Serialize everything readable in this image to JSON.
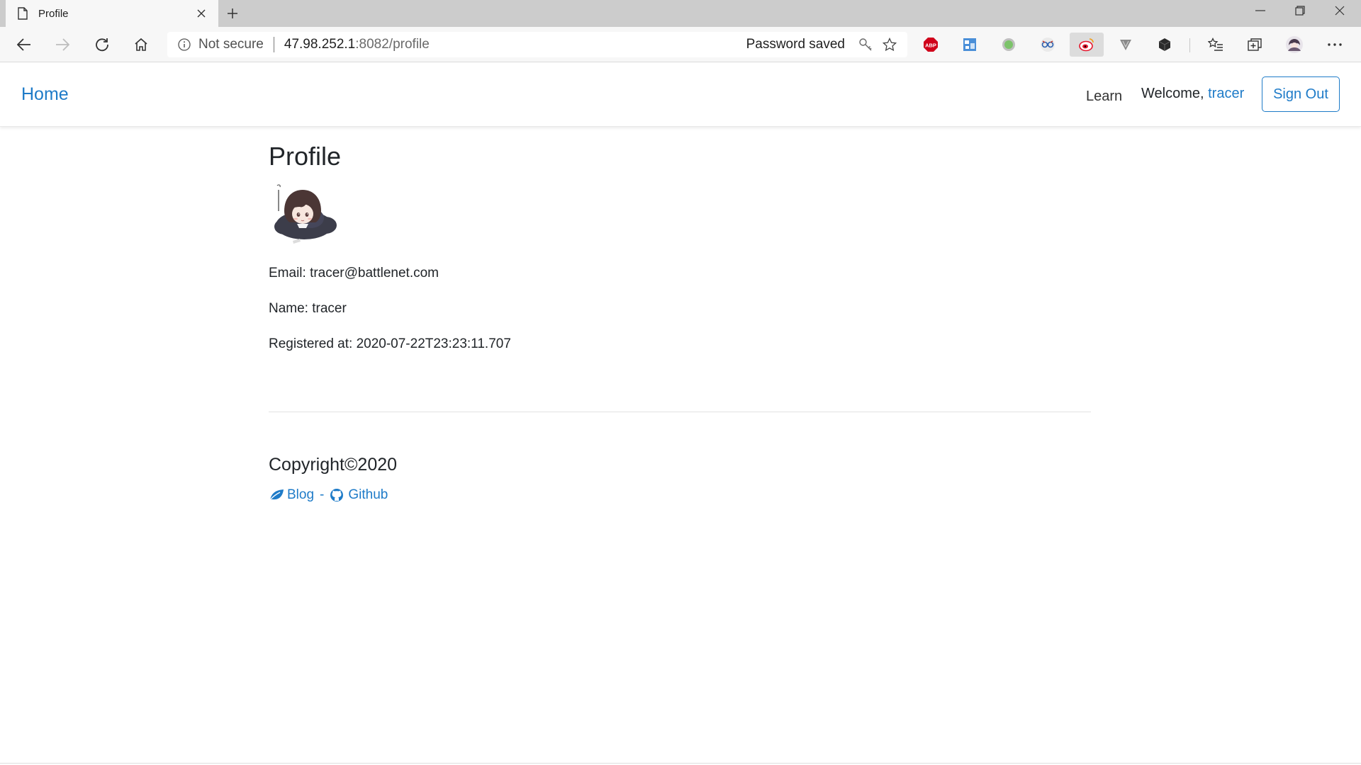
{
  "browser": {
    "tab_title": "Profile",
    "address": {
      "security_label": "Not secure",
      "url_host": "47.98.252.1",
      "url_rest": ":8082/profile",
      "password_status": "Password saved"
    },
    "extensions": [
      "adblock-icon",
      "translate-icon",
      "green-dot-icon",
      "glasses-icon",
      "weibo-icon",
      "v-shield-icon",
      "cube-icon"
    ]
  },
  "nav": {
    "brand": "Home",
    "learn": "Learn",
    "welcome_prefix": "Welcome, ",
    "username": "tracer",
    "signout": "Sign Out"
  },
  "profile": {
    "title": "Profile",
    "email_line": "Email: tracer@battlenet.com",
    "name_line": "Name: tracer",
    "registered_line": "Registered at: 2020-07-22T23:23:11.707"
  },
  "footer": {
    "copyright": "Copyright©2020",
    "blog": "Blog",
    "separator": "-",
    "github": "Github"
  },
  "colors": {
    "link": "#1e7bc8",
    "text": "#212529",
    "chrome": "#f7f7f7",
    "tabbar": "#cccccc"
  }
}
